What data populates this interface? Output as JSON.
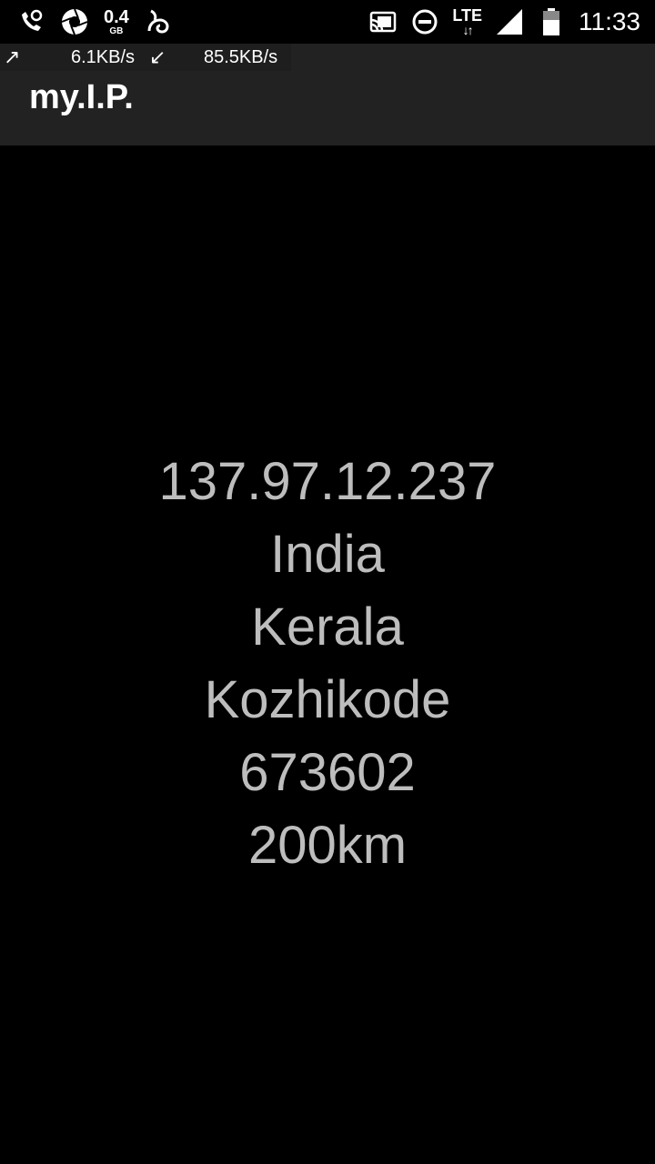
{
  "status_bar": {
    "data_usage_value": "0.4",
    "data_usage_unit": "GB",
    "network_type": "LTE",
    "network_arrows": "↓↑",
    "time": "11:33",
    "icons": {
      "left": [
        "cellular-call-icon",
        "aperture-icon",
        "data-usage-icon",
        "uc-browser-icon"
      ],
      "right": [
        "cast-icon",
        "do-not-disturb-icon",
        "lte-icon",
        "signal-icon",
        "battery-icon"
      ]
    }
  },
  "net_speed": {
    "up_arrow": "↗",
    "upload": "6.1KB/s",
    "down_arrow": "↙",
    "download": "85.5KB/s"
  },
  "app_bar": {
    "title": "my.I.P."
  },
  "info": {
    "ip": "137.97.12.237",
    "country": "India",
    "region": "Kerala",
    "city": "Kozhikode",
    "postal": "673602",
    "distance": "200km"
  },
  "colors": {
    "background": "#000000",
    "app_bar": "#222222",
    "text_primary": "#ffffff",
    "text_info": "#bdbdbd"
  }
}
